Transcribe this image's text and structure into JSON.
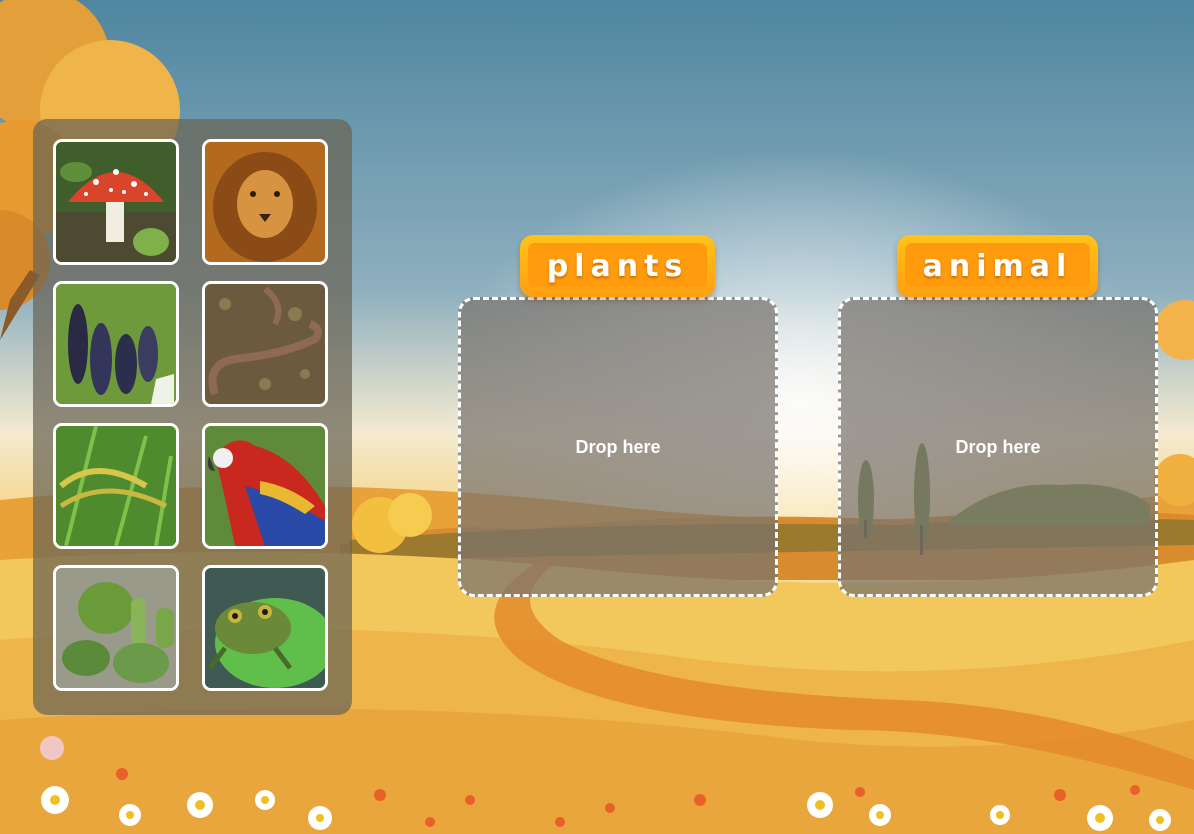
{
  "colors": {
    "sky_top": "#4f88a2",
    "sky_horizon": "#f2e6c0",
    "field": "#f0c25a",
    "label_orange": "#ff9b0c",
    "zone_fill": "#7a7570"
  },
  "tray": {
    "cards": [
      {
        "subject": "mushroom",
        "label": "mushroom"
      },
      {
        "subject": "lion",
        "label": "lion"
      },
      {
        "subject": "grapes",
        "label": "grapes"
      },
      {
        "subject": "snake",
        "label": "snake"
      },
      {
        "subject": "rice",
        "label": "rice"
      },
      {
        "subject": "parrot",
        "label": "parrot"
      },
      {
        "subject": "cactus",
        "label": "cactus"
      },
      {
        "subject": "frog",
        "label": "frog"
      }
    ]
  },
  "categories": [
    {
      "label": "plants",
      "drop_text": "Drop here"
    },
    {
      "label": "animal",
      "drop_text": "Drop here"
    }
  ]
}
